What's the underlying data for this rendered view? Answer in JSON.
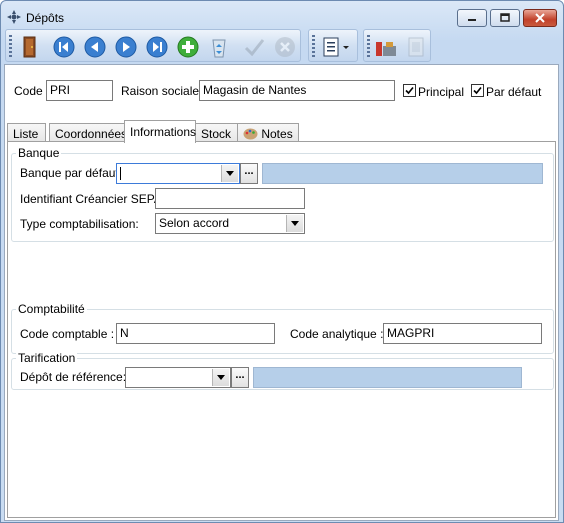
{
  "window": {
    "title": "Dépôts"
  },
  "toolbar": {
    "buttons": [
      {
        "name": "exit",
        "icon": "door-exit-icon"
      },
      {
        "name": "first",
        "icon": "first-record-icon"
      },
      {
        "name": "previous",
        "icon": "previous-record-icon"
      },
      {
        "name": "next",
        "icon": "next-record-icon"
      },
      {
        "name": "last",
        "icon": "last-record-icon"
      },
      {
        "name": "add",
        "icon": "add-icon"
      },
      {
        "name": "delete",
        "icon": "recycle-bin-icon"
      },
      {
        "name": "validate",
        "icon": "checkmark-icon",
        "disabled": true
      },
      {
        "name": "cancel",
        "icon": "cancel-icon",
        "disabled": true
      },
      {
        "name": "report-menu",
        "icon": "report-dropdown-icon"
      },
      {
        "name": "depot-tool",
        "icon": "warehouse-icon"
      },
      {
        "name": "copy",
        "icon": "document-copy-icon",
        "disabled": true
      }
    ]
  },
  "header": {
    "code_label": "Code :",
    "code_value": "PRI",
    "raison_label": "Raison sociale :",
    "raison_value": "Magasin de Nantes",
    "principal_label": "Principal",
    "principal_checked": true,
    "defaut_label": "Par défaut",
    "defaut_checked": true
  },
  "tabs": [
    {
      "label": "Liste",
      "active": false
    },
    {
      "label": "Coordonnées",
      "active": false
    },
    {
      "label": "Informations",
      "active": true
    },
    {
      "label": "Stock",
      "active": false
    },
    {
      "label": "Notes",
      "active": false,
      "icon": "notes-palette-icon"
    }
  ],
  "banque": {
    "title": "Banque",
    "banque_label": "Banque par défaut :",
    "banque_value": "",
    "sepa_label": "Identifiant Créancier SEPA:",
    "sepa_value": "",
    "type_label": "Type comptabilisation:",
    "type_value": "Selon accord"
  },
  "comptabilite": {
    "title": "Comptabilité",
    "code_label": "Code comptable :",
    "code_value": "N",
    "analytique_label": "Code analytique :",
    "analytique_value": "MAGPRI"
  },
  "tarification": {
    "title": "Tarification",
    "depot_label": "Dépôt de référence:",
    "depot_value": ""
  },
  "ellipsis": "...",
  "colors": {
    "accent_field": "#b6cfe9",
    "window_frame": "#c5d9f1"
  }
}
